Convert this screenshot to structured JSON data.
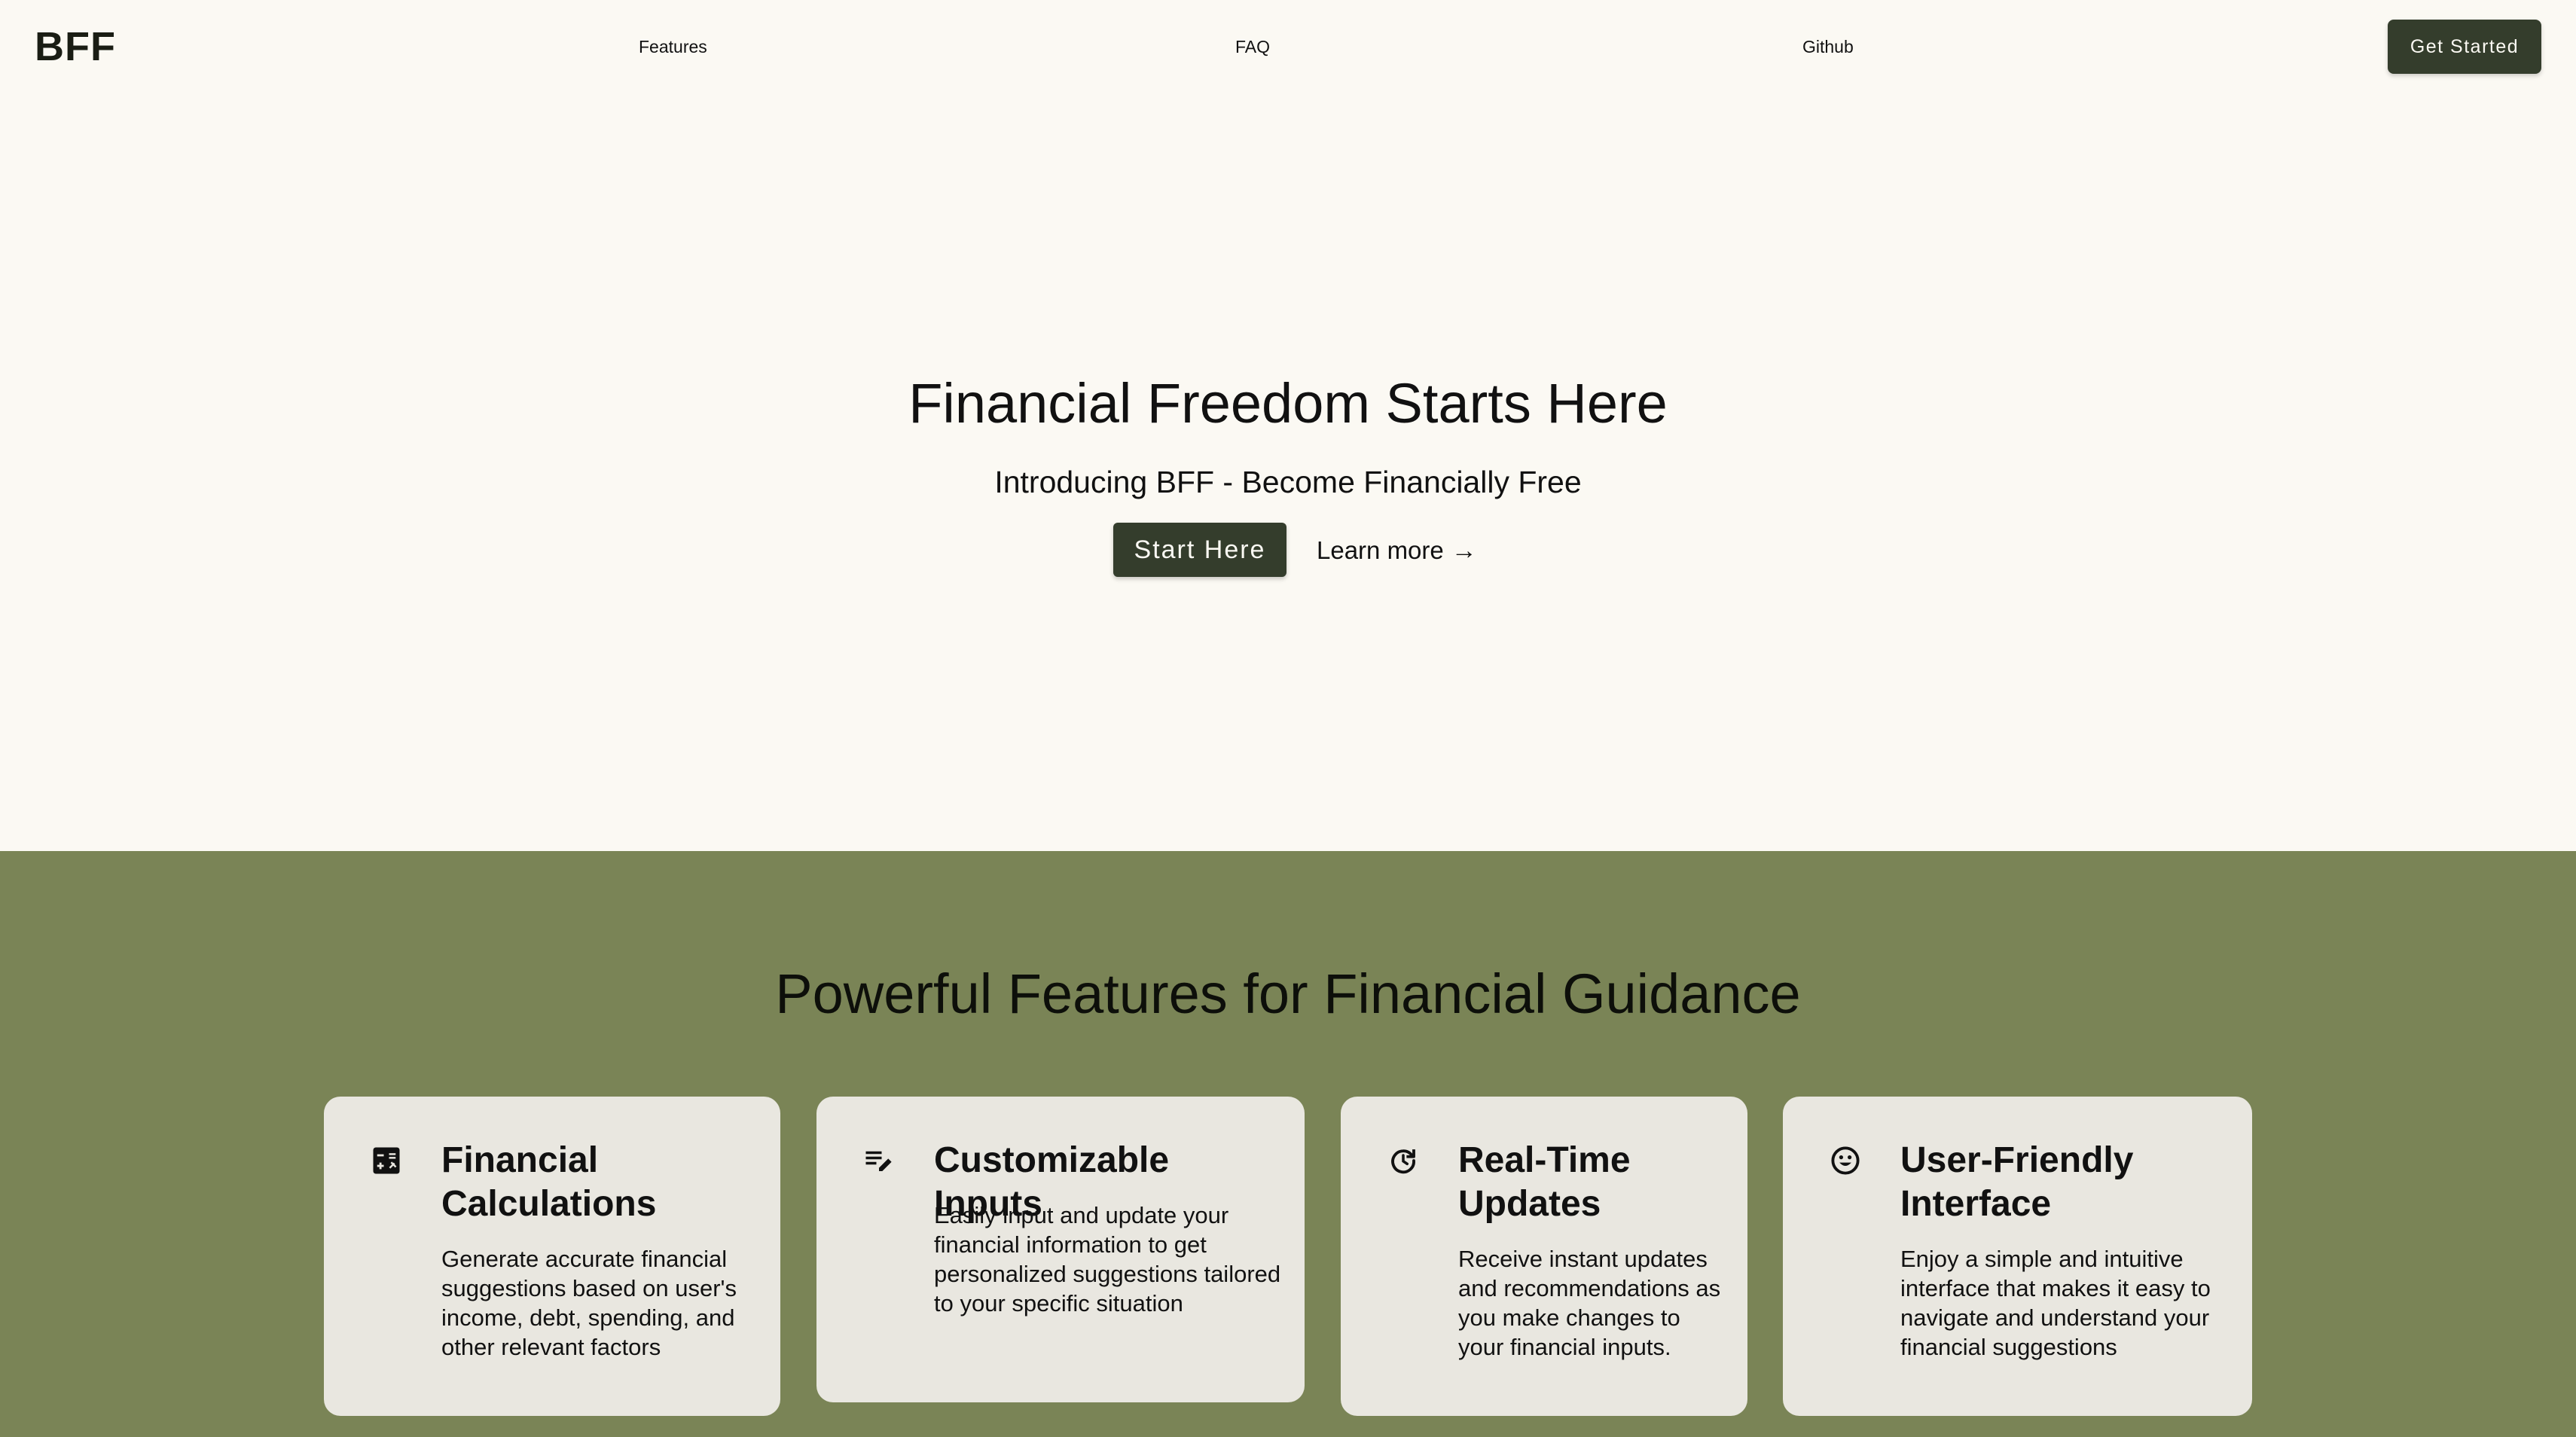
{
  "nav": {
    "logo": "BFF",
    "links": [
      "Features",
      "FAQ",
      "Github"
    ],
    "cta_label": "Get Started"
  },
  "hero": {
    "title": "Financial Freedom Starts Here",
    "subtitle": "Introducing BFF - Become Financially Free",
    "primary_button": "Start Here",
    "secondary_link": "Learn more",
    "secondary_icon": "arrow-right-icon"
  },
  "features": {
    "title": "Powerful Features for Financial Guidance",
    "background_color": "#7a8456",
    "cards": [
      {
        "icon": "calculator-icon",
        "title": "Financial Calculations",
        "text": "Generate accurate financial suggestions based on user's income, debt, spending, and other relevant factors"
      },
      {
        "icon": "edit-list-icon",
        "title": "Customizable Inputs",
        "text": "Easily input and update your financial information to get personalized suggestions tailored to your specific situation"
      },
      {
        "icon": "refresh-icon",
        "title": "Real-Time Updates",
        "text": "Receive instant updates and recommendations as you make changes to your financial inputs."
      },
      {
        "icon": "smiley-face-icon",
        "title": "User-Friendly Interface",
        "text": "Enjoy a simple and intuitive interface that makes it easy to navigate and understand your financial suggestions"
      }
    ]
  },
  "colors": {
    "page_background": "#fbf9f3",
    "button_dark": "#343d2c",
    "card_background": "#e9e7e0"
  }
}
